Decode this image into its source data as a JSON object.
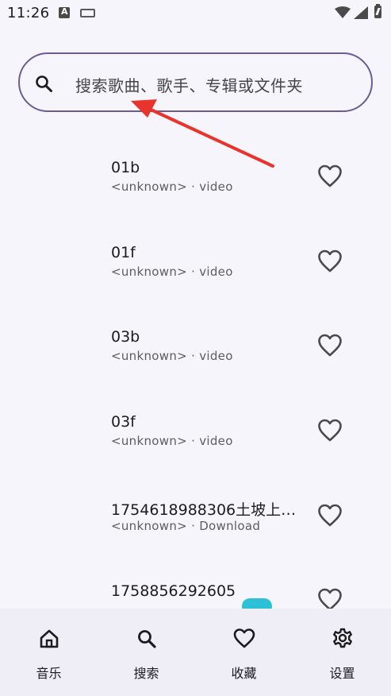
{
  "status_bar": {
    "time": "11:26",
    "a_icon": "A"
  },
  "search": {
    "placeholder": "搜索歌曲、歌手、专辑或文件夹"
  },
  "songs": [
    {
      "title": "01b",
      "subtitle": "<unknown> · video",
      "favorited": false
    },
    {
      "title": "01f",
      "subtitle": "<unknown> · video",
      "favorited": false
    },
    {
      "title": "03b",
      "subtitle": "<unknown> · video",
      "favorited": false
    },
    {
      "title": "03f",
      "subtitle": "<unknown> · video",
      "favorited": false
    },
    {
      "title": "1754618988306土坡上…",
      "subtitle": "<unknown> · Download",
      "favorited": false
    },
    {
      "title": "1758856292605",
      "subtitle": "",
      "favorited": false
    }
  ],
  "bottom_nav": {
    "items": [
      {
        "label": "音乐",
        "icon": "home-icon",
        "active": false
      },
      {
        "label": "搜索",
        "icon": "search-icon",
        "active": true
      },
      {
        "label": "收藏",
        "icon": "heart-icon",
        "active": false
      },
      {
        "label": "设置",
        "icon": "gear-icon",
        "active": false
      }
    ]
  },
  "colors": {
    "accent_border": "#6b5c94",
    "annotation_arrow": "#e8342c",
    "badge": "#2dc1d8",
    "nav_active_pill": "#ddd8ea"
  }
}
